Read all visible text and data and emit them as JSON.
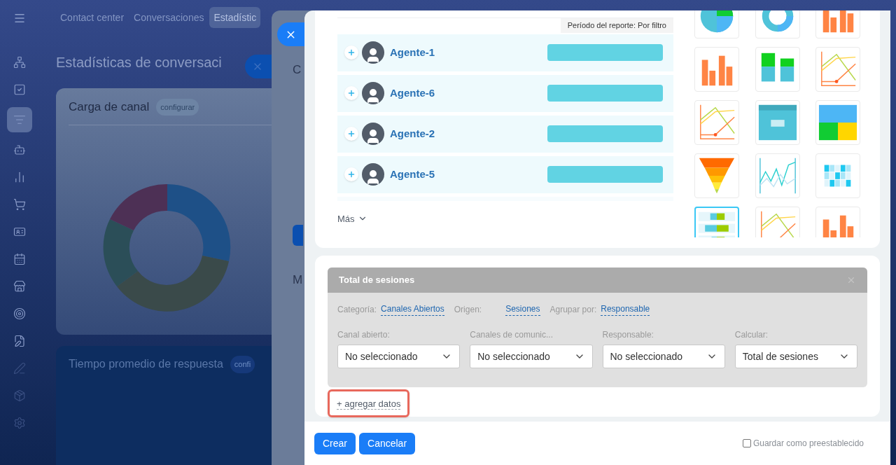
{
  "sidebar": {
    "items": [
      {
        "selected": false
      },
      {
        "selected": false
      },
      {
        "selected": true
      },
      {
        "selected": false
      },
      {
        "selected": false
      },
      {
        "selected": false
      },
      {
        "selected": false
      },
      {
        "selected": false
      },
      {
        "selected": false
      },
      {
        "selected": false
      },
      {
        "selected": false
      },
      {
        "selected": false
      },
      {
        "selected": false
      },
      {
        "selected": false
      }
    ]
  },
  "tabs": [
    {
      "label": "Contact center",
      "selected": false
    },
    {
      "label": "Conversaciones",
      "selected": false
    },
    {
      "label": "Estadístic",
      "selected": true
    }
  ],
  "page_title": "Estadísticas de conversaci",
  "cards": [
    {
      "title": "Carga de canal",
      "action": "configurar"
    },
    {
      "title": "Tiempo promedio de respuesta",
      "action": "confi"
    }
  ],
  "middle_panel": {
    "texts": [
      "C",
      "M"
    ]
  },
  "report": {
    "period": "Período del reporte: Por filtro",
    "agents": [
      {
        "name": "Agente-1"
      },
      {
        "name": "Agente-6"
      },
      {
        "name": "Agente-2"
      },
      {
        "name": "Agente-5"
      }
    ],
    "more": "Más"
  },
  "chart_types": [
    {
      "kind": "pie",
      "selected": false
    },
    {
      "kind": "donut",
      "selected": false
    },
    {
      "kind": "columns",
      "selected": false
    },
    {
      "kind": "columns",
      "selected": false
    },
    {
      "kind": "stacked",
      "selected": false
    },
    {
      "kind": "line",
      "selected": false
    },
    {
      "kind": "line",
      "selected": false
    },
    {
      "kind": "number",
      "selected": false
    },
    {
      "kind": "tiles",
      "selected": false
    },
    {
      "kind": "funnel",
      "selected": false
    },
    {
      "kind": "wave",
      "selected": false
    },
    {
      "kind": "heatmap",
      "selected": false
    },
    {
      "kind": "hbars",
      "selected": true
    },
    {
      "kind": "line",
      "selected": false
    },
    {
      "kind": "columns",
      "selected": false
    }
  ],
  "dataset": {
    "title": "Total de sesiones",
    "meta": [
      {
        "label": "Categoría:",
        "value": "Canales Abiertos"
      },
      {
        "label": "Origen:",
        "value": "Sesiones"
      },
      {
        "label": "Agrupar por:",
        "value": "Responsable"
      }
    ],
    "filters": [
      {
        "label": "Canal abierto:",
        "value": "No seleccionado"
      },
      {
        "label": "Canales de comunic...",
        "value": "No seleccionado"
      },
      {
        "label": "Responsable:",
        "value": "No seleccionado"
      },
      {
        "label": "Calcular:",
        "value": "Total de sesiones"
      }
    ],
    "add_link": "+ agregar datos",
    "add_highlighted": true
  },
  "footer": {
    "buttons": [
      "Crear",
      "Cancelar"
    ],
    "save_preset": {
      "label": "Guardar como preestablecido",
      "checked": false
    }
  }
}
